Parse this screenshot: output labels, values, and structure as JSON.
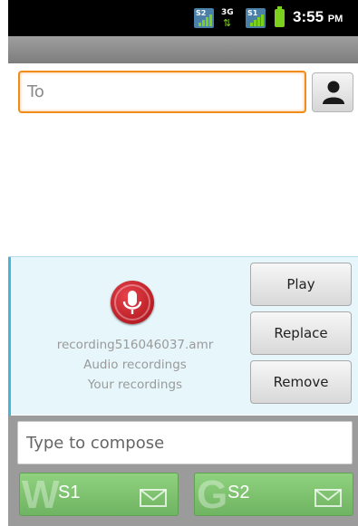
{
  "status_bar": {
    "sim1_signal_label": "S2",
    "network_label": "3G",
    "sim2_signal_label": "S1",
    "time": "3:55",
    "ampm": "PM"
  },
  "recipients": {
    "to_placeholder": "To",
    "to_value": ""
  },
  "attachment": {
    "file_name": "recording516046037.amr",
    "type_label": "Audio recordings",
    "source_label": "Your recordings",
    "play_label": "Play",
    "replace_label": "Replace",
    "remove_label": "Remove"
  },
  "compose": {
    "placeholder": "Type to compose",
    "value": ""
  },
  "send_buttons": [
    {
      "label": "S1",
      "watermark": "W"
    },
    {
      "label": "S2",
      "watermark": "G"
    }
  ],
  "colors": {
    "focus_accent": "#f08c1a",
    "panel_accent": "#47b5d6",
    "send_green": "#7fc271",
    "mic_red": "#c8161e"
  }
}
